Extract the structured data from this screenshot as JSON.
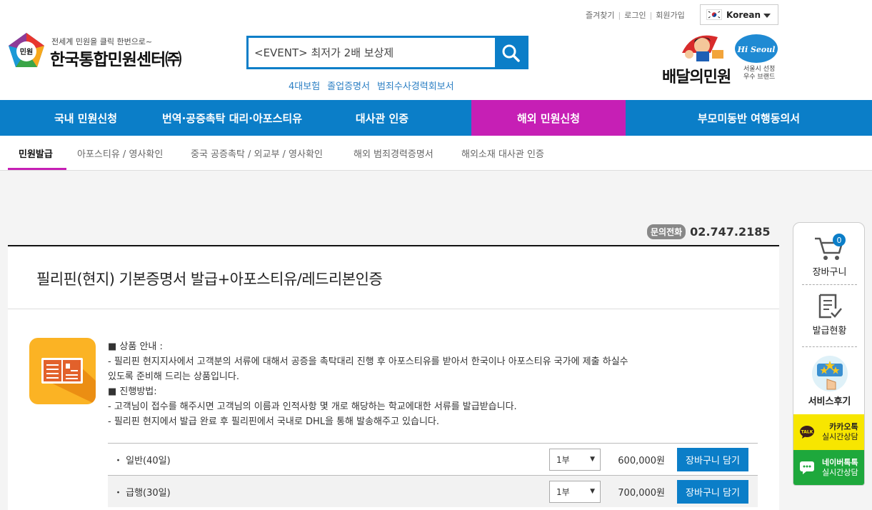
{
  "header": {
    "util_links": [
      "즐겨찾기",
      "로그인",
      "회원가입"
    ],
    "language": "Korean",
    "logo_tagline": "전세계 민원을 클릭 한번으로~",
    "logo_name": "한국통합민원센터㈜",
    "logo_badge": "민원",
    "search_value": "<EVENT> 최저가 2배 보상제",
    "quick_links": [
      "4대보험",
      "졸업증명서",
      "범죄수사경력회보서"
    ],
    "promo_title": "배달의민원",
    "promo_badge": "Hi Seoul",
    "promo_sub": "서울시 선정 우수 브랜드"
  },
  "main_nav": [
    {
      "label": "국내 민원신청",
      "active": false
    },
    {
      "label": "번역·공증촉탁 대리·아포스티유",
      "active": false
    },
    {
      "label": "대사관 인증",
      "active": false
    },
    {
      "label": "해외 민원신청",
      "active": true
    },
    {
      "label": "부모미동반 여행동의서",
      "active": false
    }
  ],
  "sub_nav": [
    "민원발급",
    "아포스티유 / 영사확인",
    "중국 공증촉탁 / 외교부 / 영사확인",
    "해외 범죄경력증명서",
    "해외소재 대사관 인증"
  ],
  "contact": {
    "label": "문의전화",
    "number": "02.747.2185"
  },
  "product": {
    "title": "필리핀(현지) 기본증명서 발급+아포스티유/레드리본인증",
    "desc": [
      "■ 상품 안내 :",
      "- 필리핀 현지지사에서 고객분의 서류에 대해서 공증을 촉탁대리 진행 후 아포스티유를 받아서 한국이나 아포스티유 국가에 제출 하실수",
      "있도록 준비해 드리는 상품입니다.",
      "■ 진행방법:",
      "- 고객님이 접수를 해주시면 고객님의 이름과 인적사항 몇 개로 해당하는 학교에대한 서류를 발급받습니다.",
      "- 필리핀 현지에서 발급 완료 후 필리핀에서 국내로 DHL을 통해 발송해주고 있습니다."
    ],
    "options": [
      {
        "name": "일반(40일)",
        "qty": "1부",
        "price": "600,000원",
        "button": "장바구니 담기"
      },
      {
        "name": "급행(30일)",
        "qty": "1부",
        "price": "700,000원",
        "button": "장바구니 담기"
      }
    ]
  },
  "sidebar": {
    "cart_label": "장바구니",
    "cart_count": "0",
    "status_label": "발급현황",
    "review_label": "서비스후기",
    "kakao_badge": "TALK",
    "kakao_line1": "카카오톡",
    "kakao_line2": "실시간상담",
    "naver_line1": "네이버톡톡",
    "naver_line2": "실시간상담"
  },
  "colors": {
    "primary_blue": "#0b7ec8",
    "active_magenta": "#c61fb5",
    "kakao_yellow": "#f7e600",
    "naver_green": "#1ea83c",
    "icon_orange": "#fbb324"
  }
}
